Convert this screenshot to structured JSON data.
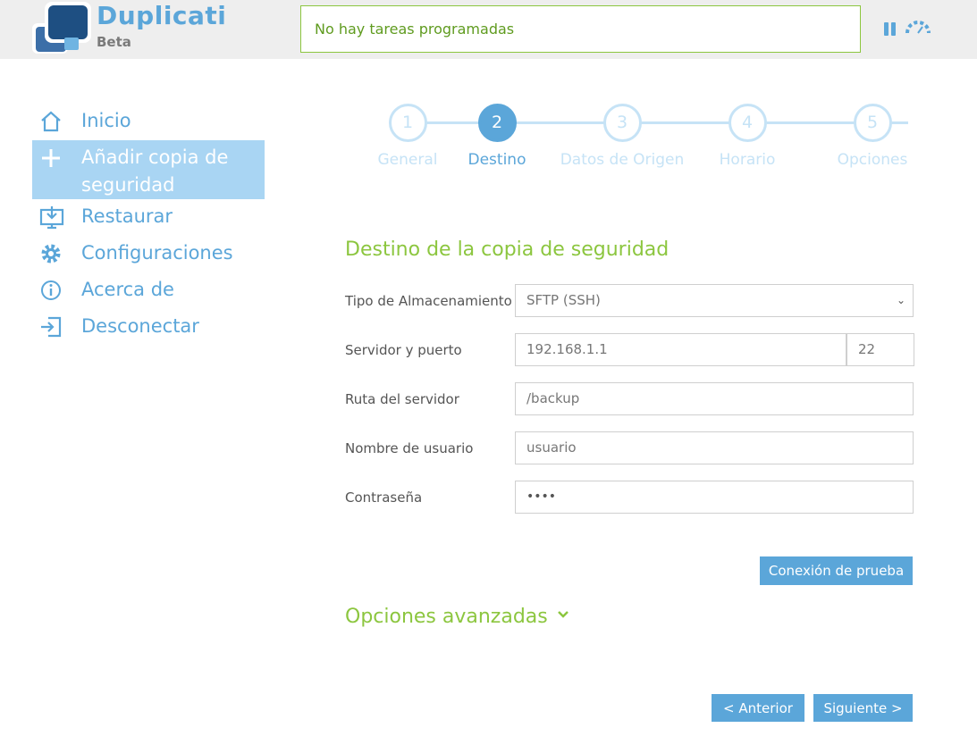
{
  "header": {
    "brand_title": "Duplicati",
    "brand_subtitle": "Beta",
    "status_text": "No hay tareas programadas"
  },
  "sidebar": {
    "items": [
      {
        "label": "Inicio",
        "icon": "home-icon"
      },
      {
        "label": "Añadir copia de seguridad",
        "icon": "plus-icon",
        "active": true
      },
      {
        "label": "Restaurar",
        "icon": "restore-icon"
      },
      {
        "label": "Configuraciones",
        "icon": "gear-icon"
      },
      {
        "label": "Acerca de",
        "icon": "info-icon"
      },
      {
        "label": "Desconectar",
        "icon": "logout-icon"
      }
    ]
  },
  "stepper": {
    "steps": [
      {
        "number": "1",
        "label": "General"
      },
      {
        "number": "2",
        "label": "Destino",
        "active": true
      },
      {
        "number": "3",
        "label": "Datos de Origen"
      },
      {
        "number": "4",
        "label": "Horario"
      },
      {
        "number": "5",
        "label": "Opciones"
      }
    ]
  },
  "form": {
    "title": "Destino de la copia de seguridad",
    "storage_type_label": "Tipo de Almacenamiento",
    "storage_type_value": "SFTP (SSH)",
    "server_label": "Servidor y puerto",
    "server_value": "192.168.1.1",
    "port_value": "22",
    "path_label": "Ruta del servidor",
    "path_value": "/backup",
    "username_label": "Nombre de usuario",
    "username_value": "usuario",
    "password_label": "Contraseña",
    "password_value": "••••",
    "test_connection_label": "Conexión de prueba",
    "advanced_label": "Opciones avanzadas",
    "prev_label": "< Anterior",
    "next_label": "Siguiente >"
  },
  "colors": {
    "accent_blue": "#5ba6d9",
    "accent_green": "#8cc63f",
    "active_nav_bg": "#a9d5f3"
  }
}
